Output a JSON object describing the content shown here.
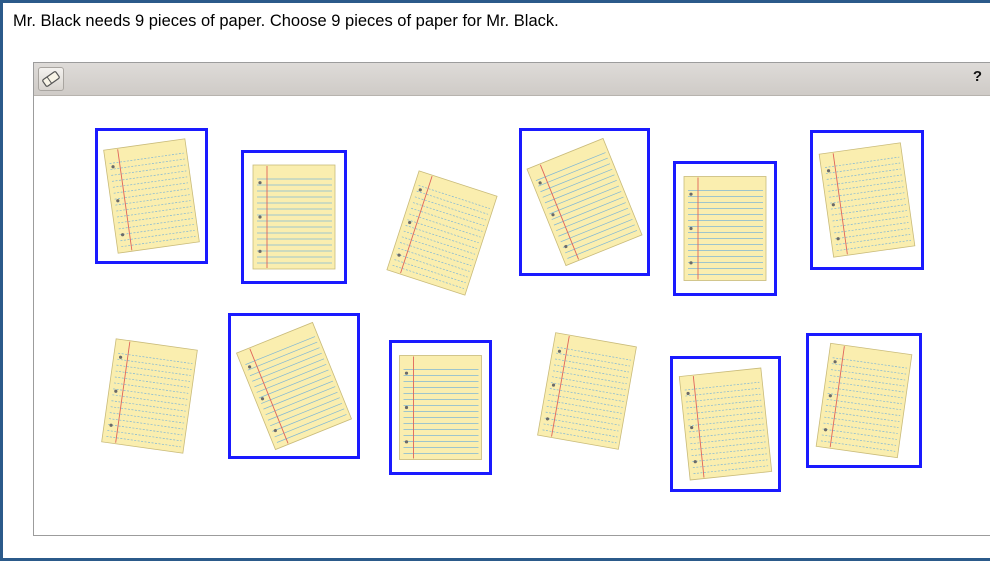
{
  "question": "Mr. Black needs 9 pieces of paper. Choose 9 pieces of paper for Mr. Black.",
  "toolbar": {
    "eraser_icon": "eraser-icon",
    "help_label": "?"
  },
  "colors": {
    "selection_border": "#1a1aff",
    "paper": "#faeeaf",
    "paper_lines": "#7fb7d6",
    "margin_line": "#e0645a"
  },
  "papers": [
    {
      "id": 1,
      "selected": true
    },
    {
      "id": 2,
      "selected": true
    },
    {
      "id": 3,
      "selected": false
    },
    {
      "id": 4,
      "selected": true
    },
    {
      "id": 5,
      "selected": true
    },
    {
      "id": 6,
      "selected": true
    },
    {
      "id": 7,
      "selected": false
    },
    {
      "id": 8,
      "selected": true
    },
    {
      "id": 9,
      "selected": true
    },
    {
      "id": 10,
      "selected": false
    },
    {
      "id": 11,
      "selected": true
    },
    {
      "id": 12,
      "selected": true
    }
  ]
}
